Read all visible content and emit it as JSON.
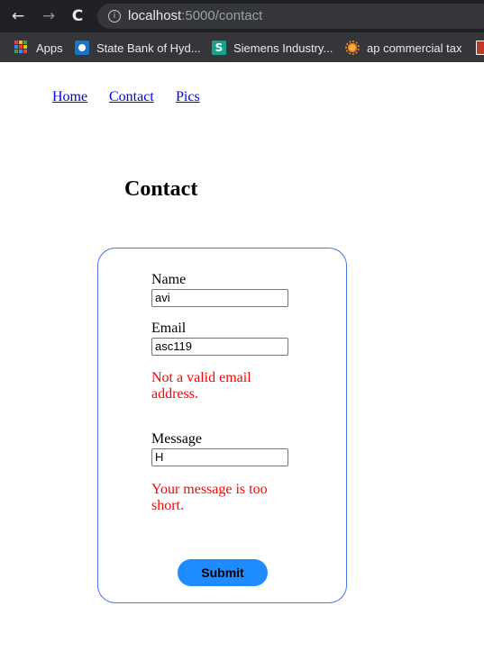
{
  "browser": {
    "back_icon": "←",
    "forward_icon": "→",
    "reload_icon": "C",
    "url_host": "localhost",
    "url_path": ":5000/contact",
    "bookmarks": [
      {
        "label": "Apps",
        "icon": "apps-grid-icon"
      },
      {
        "label": "State Bank of Hyd...",
        "icon": "sbh-icon"
      },
      {
        "label": "Siemens Industry...",
        "icon": "siemens-icon"
      },
      {
        "label": "ap commercial tax",
        "icon": "ap-commercial-tax-icon"
      }
    ]
  },
  "nav": {
    "home": "Home",
    "contact": "Contact",
    "pics": "Pics"
  },
  "page": {
    "title": "Contact"
  },
  "form": {
    "name_label": "Name",
    "name_value": "avi",
    "email_label": "Email",
    "email_value": "asc119",
    "email_error": "Not a valid email address.",
    "message_label": "Message",
    "message_value": "H",
    "message_error": "Your message is too short.",
    "submit_label": "Submit"
  },
  "colors": {
    "link": "#0000ee",
    "error": "#ff0000",
    "card_border": "#4a72e8",
    "submit_bg": "#1e8cff"
  }
}
